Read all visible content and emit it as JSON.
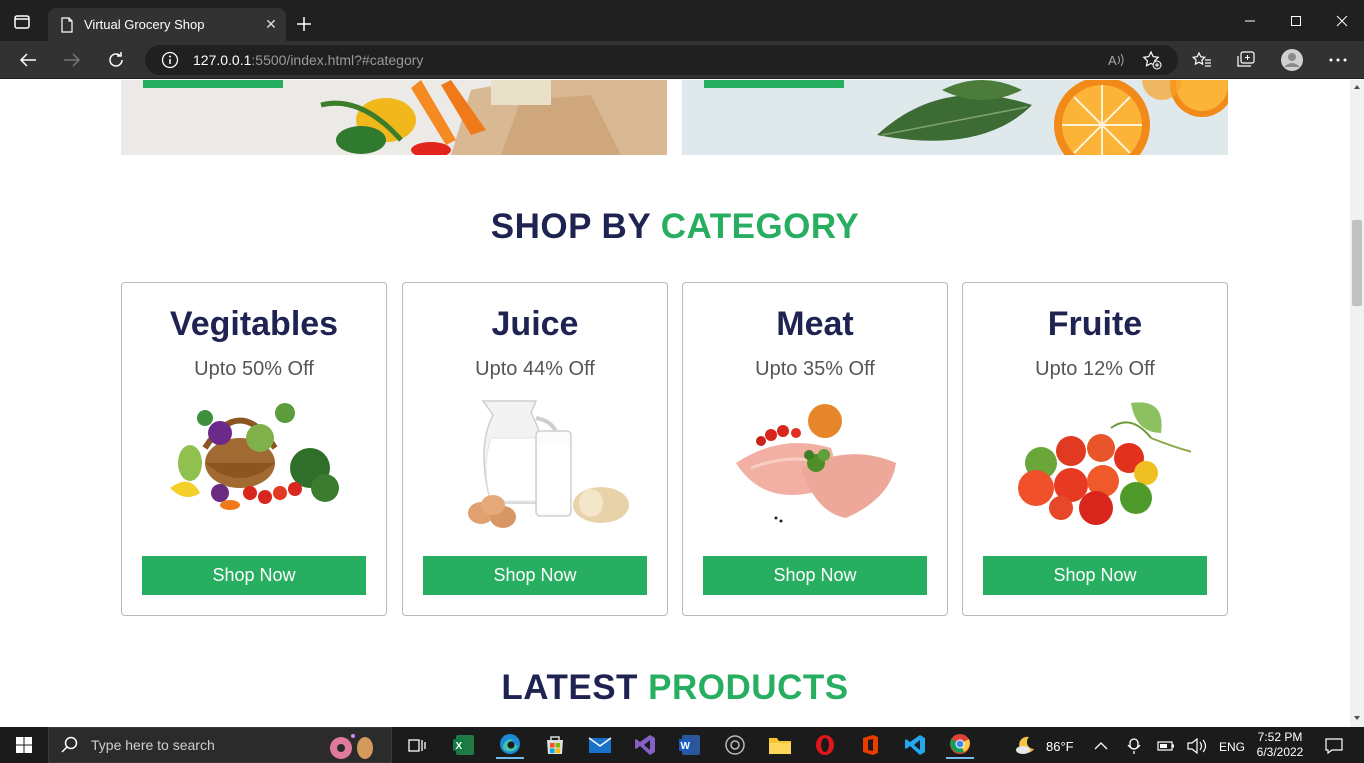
{
  "browser": {
    "tab_title": "Virtual Grocery Shop",
    "url_host": "127.0.0.1",
    "url_rest": ":5500/index.html?#category"
  },
  "sections": {
    "category_title_part1": "SHOP BY",
    "category_title_part2": "CATEGORY",
    "latest_title_part1": "LATEST",
    "latest_title_part2": "PRODUCTS"
  },
  "categories": [
    {
      "name": "Vegitables",
      "discount": "Upto 50% Off",
      "button": "Shop Now",
      "image": "vegetable-basket"
    },
    {
      "name": "Juice",
      "discount": "Upto 44% Off",
      "button": "Shop Now",
      "image": "milk-eggs-bread"
    },
    {
      "name": "Meat",
      "discount": "Upto 35% Off",
      "button": "Shop Now",
      "image": "chicken-breast"
    },
    {
      "name": "Fruite",
      "discount": "Upto 12% Off",
      "button": "Shop Now",
      "image": "fruit-pile"
    }
  ],
  "taskbar": {
    "search_placeholder": "Type here to search",
    "weather": "86°F",
    "language": "ENG",
    "time": "7:52 PM",
    "date": "6/3/2022"
  },
  "colors": {
    "accent": "#27ae60",
    "heading": "#1f2352"
  }
}
